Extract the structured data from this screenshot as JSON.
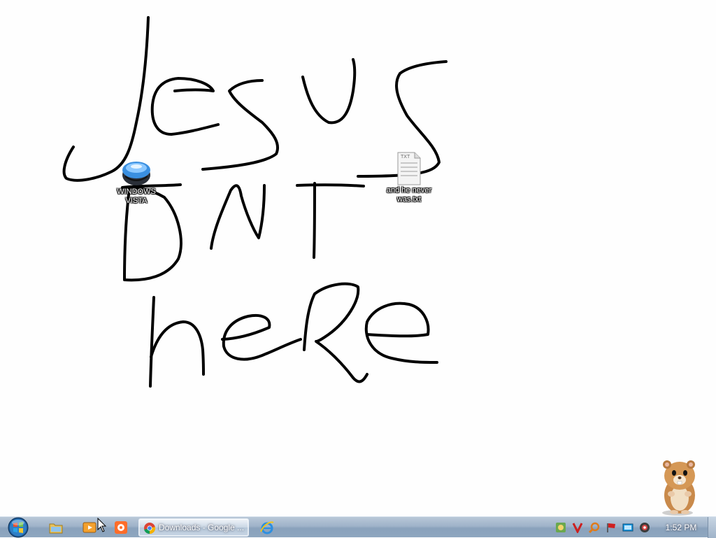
{
  "desktop": {
    "drawing_text": [
      "Jesus",
      "DNT",
      "heRe"
    ],
    "icons": [
      {
        "label": "WINDOWS VISTA",
        "icon": "orb-globe-icon"
      },
      {
        "label": "and he never was.txt",
        "icon": "text-file-icon",
        "badge": "TXT"
      }
    ],
    "mascot": "hamster-mascot"
  },
  "taskbar": {
    "start": "start-orb-icon",
    "pinned": [
      "explorer-folder-icon",
      "media-player-icon",
      "media-app-icon"
    ],
    "active_task": {
      "label": "Downloads - Google ...",
      "icon": "chrome-icon"
    },
    "pinned_after": [
      "internet-explorer-icon"
    ],
    "tray_icons": [
      "security-tray-icon",
      "v-tray-icon",
      "search-tray-icon",
      "flag-tray-icon",
      "display-tray-icon",
      "volume-tray-icon"
    ],
    "clock": "1:52 PM"
  },
  "colors": {
    "taskbar_top": "#b9c8d8",
    "taskbar_bottom": "#8ea6bf",
    "desktop_bg": "#fefefe",
    "ink": "#000000"
  }
}
